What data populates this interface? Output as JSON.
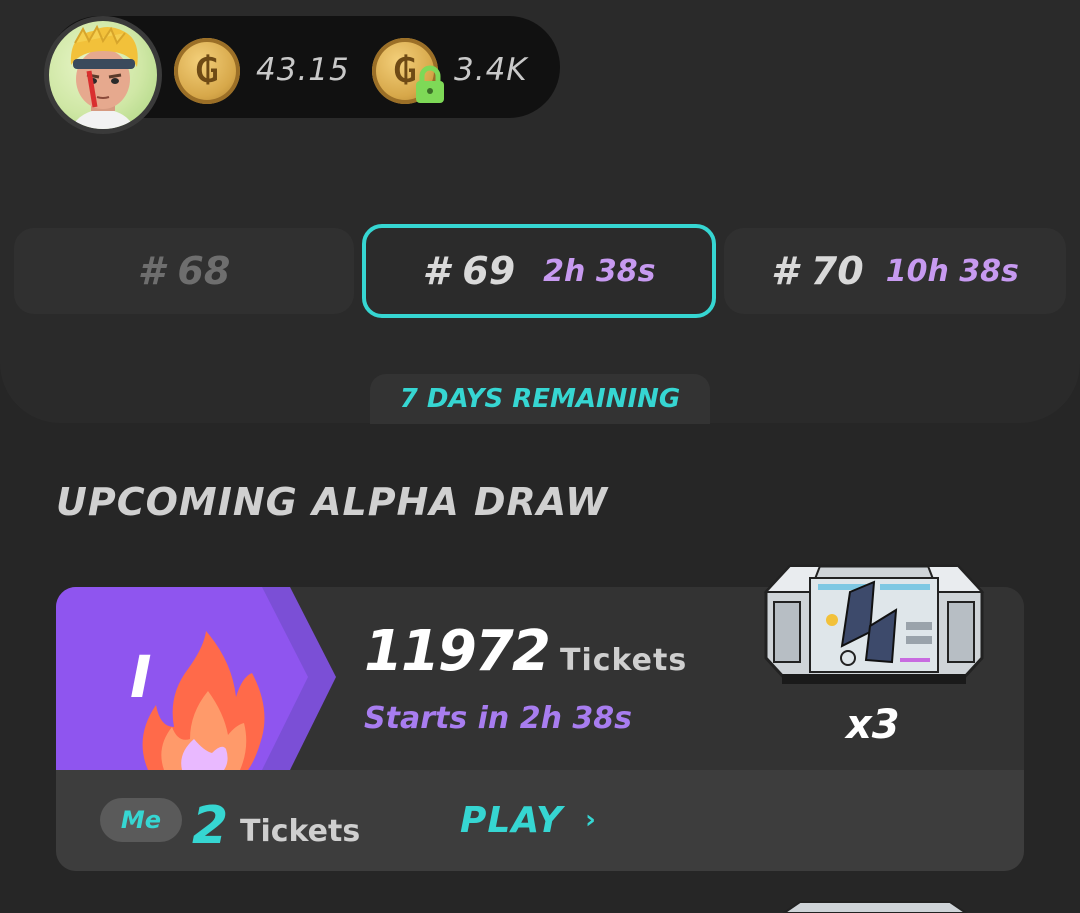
{
  "header": {
    "balance_primary": "43.15",
    "balance_locked": "3.4K",
    "coin_icon": "coin-icon",
    "lock_icon": "lock-icon"
  },
  "rounds": [
    {
      "number": "# 68",
      "time": "",
      "state": "past"
    },
    {
      "number": "# 69",
      "time": "2h 38s",
      "state": "active"
    },
    {
      "number": "# 70",
      "time": "10h 38s",
      "state": "upcoming"
    }
  ],
  "days_remaining": "7 DAYS REMAINING",
  "section_title": "UPCOMING ALPHA DRAW",
  "draw": {
    "tier": "I",
    "ticket_count": "11972",
    "ticket_unit": "Tickets",
    "starts_in": "Starts in 2h 38s",
    "multiplier": "x3",
    "me_label": "Me",
    "my_tickets": "2",
    "my_tickets_unit": "Tickets",
    "play_label": "PLAY",
    "play_chevron": "›"
  },
  "colors": {
    "accent_cyan": "#36d6d2",
    "accent_purple": "#a87df0",
    "badge_purple": "#8f55ef"
  }
}
